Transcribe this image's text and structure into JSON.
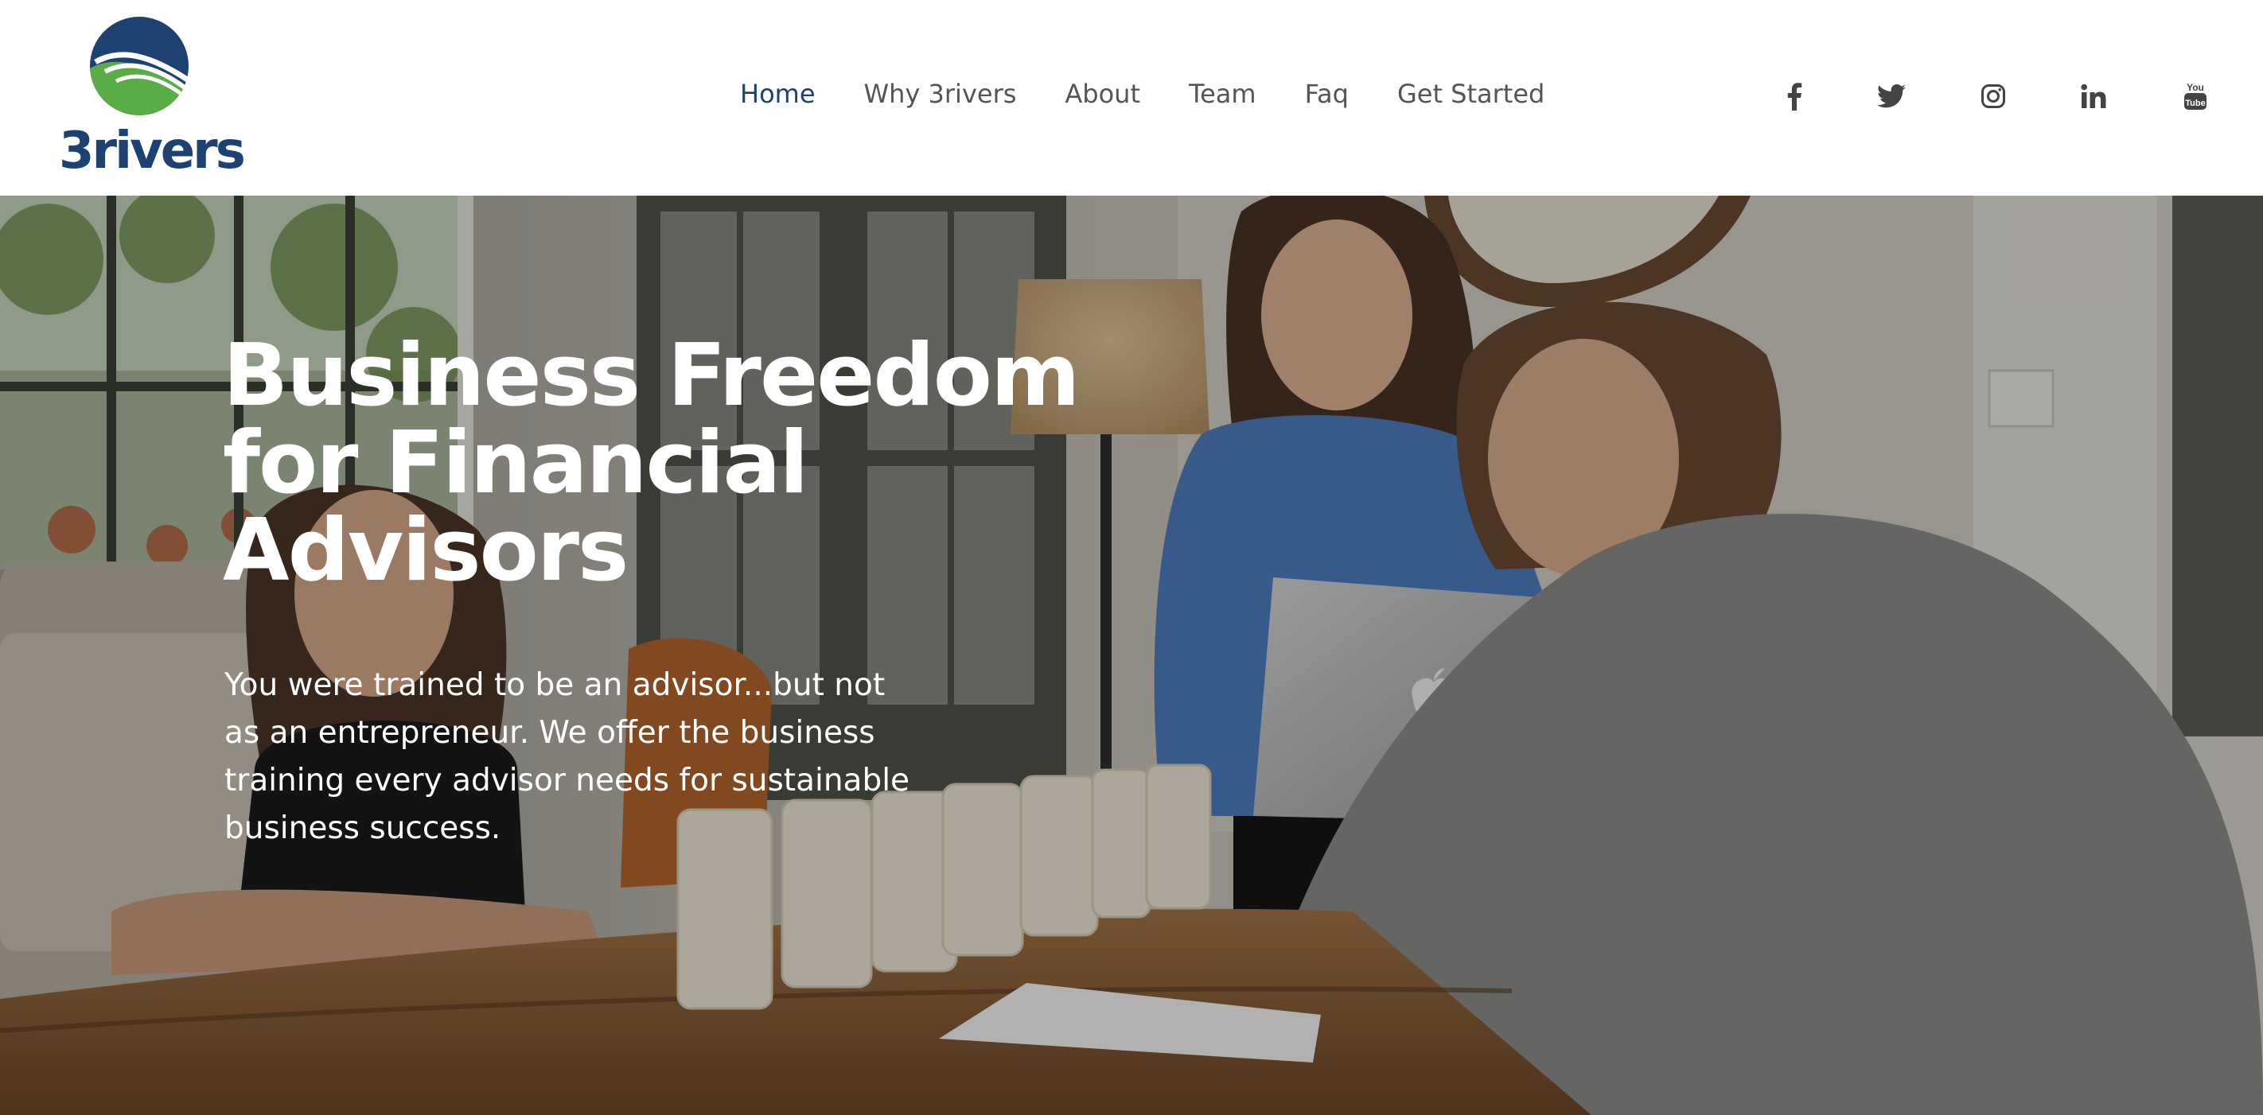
{
  "brand": {
    "name": "3rivers",
    "colors": {
      "navy": "#1d4170",
      "green": "#5aac46",
      "nav_text": "#555555"
    }
  },
  "nav": {
    "items": [
      {
        "label": "Home",
        "active": true
      },
      {
        "label": "Why 3rivers",
        "active": false
      },
      {
        "label": "About",
        "active": false
      },
      {
        "label": "Team",
        "active": false
      },
      {
        "label": "Faq",
        "active": false
      },
      {
        "label": "Get Started",
        "active": false
      }
    ]
  },
  "social": [
    {
      "icon": "facebook-icon"
    },
    {
      "icon": "twitter-icon"
    },
    {
      "icon": "instagram-icon"
    },
    {
      "icon": "linkedin-icon"
    },
    {
      "icon": "youtube-icon"
    }
  ],
  "hero": {
    "title": "Business Freedom for Financial Advisors",
    "subtitle": "You were trained to be an advisor...but not as an entrepreneur. We offer the business training every advisor needs for sustainable business success."
  }
}
